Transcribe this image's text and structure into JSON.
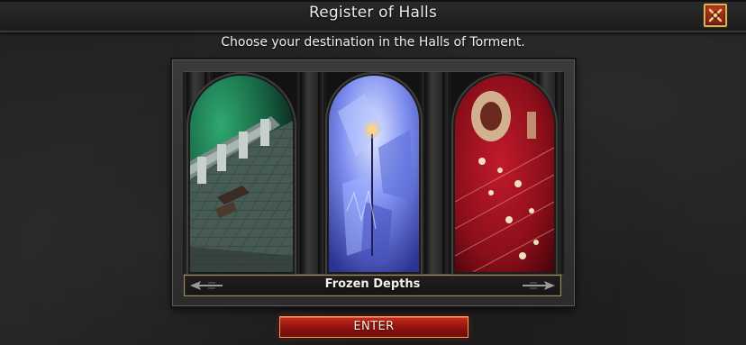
{
  "window": {
    "title": "Register of Halls",
    "close_icon": "close-x-icon"
  },
  "header": {
    "subtitle": "Choose your destination in the Halls of Torment."
  },
  "destinations": [
    {
      "theme": "green-crypt"
    },
    {
      "theme": "frozen-ice"
    },
    {
      "theme": "red-bone"
    }
  ],
  "selector": {
    "current": "Frozen Depths",
    "prev_icon": "arrow-left-icon",
    "next_icon": "arrow-right-icon"
  },
  "actions": {
    "enter_label": "ENTER"
  },
  "colors": {
    "accent_gold": "#d8b35c",
    "enter_red": "#c92b1b",
    "panel_bg": "#232324"
  }
}
